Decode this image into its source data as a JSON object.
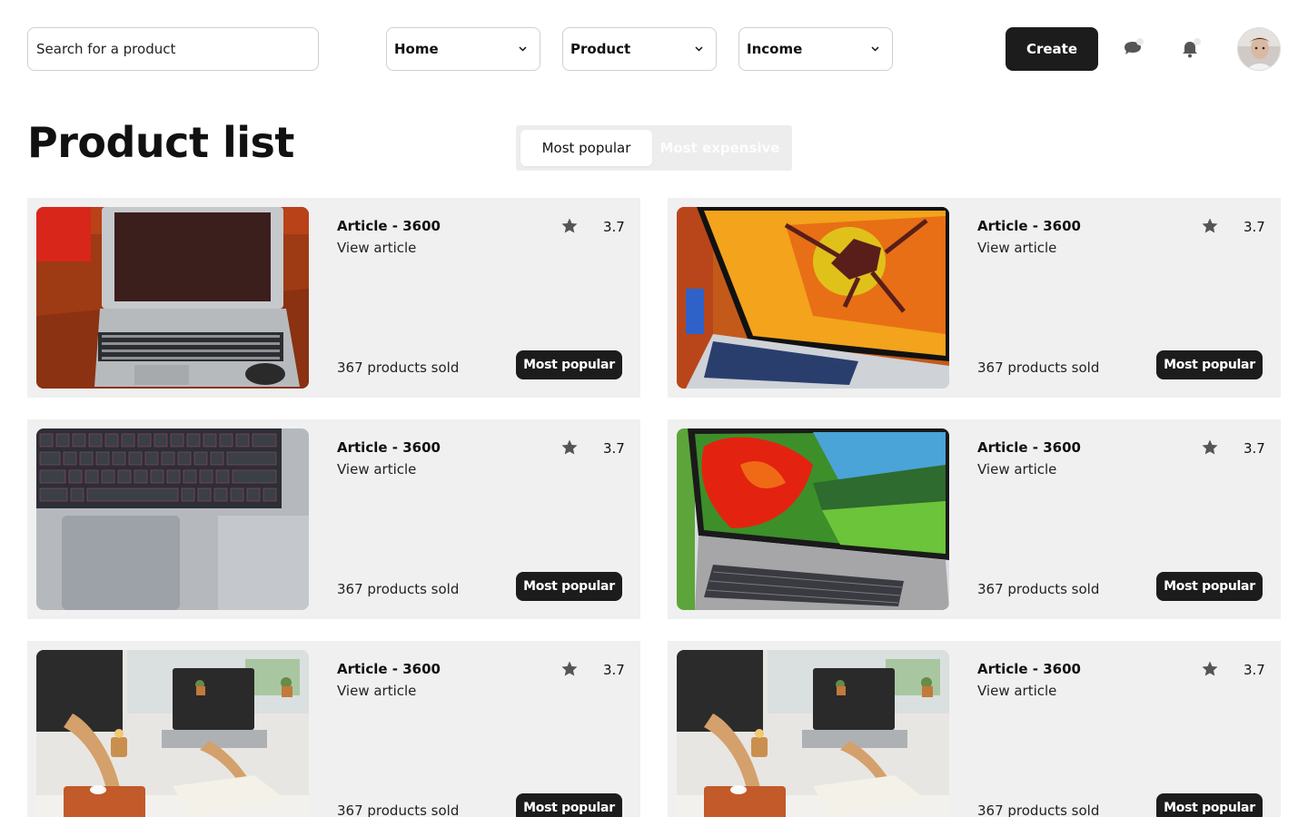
{
  "search": {
    "placeholder": "Search for a product",
    "value": ""
  },
  "nav": {
    "dropdowns": [
      {
        "label": "Home"
      },
      {
        "label": "Product"
      },
      {
        "label": "Income"
      }
    ],
    "create_label": "Create",
    "icons": [
      "chat-icon",
      "bell-icon",
      "avatar"
    ]
  },
  "page": {
    "title": "Product list",
    "tabs": [
      {
        "label": "Most popular",
        "active": true
      },
      {
        "label": "Most expensive",
        "active": false
      }
    ]
  },
  "colors": {
    "accent": "#1c1c1c",
    "card_bg": "#f0f0f0",
    "tab_bg": "#ededed",
    "star": "#555555"
  },
  "products": [
    {
      "title": "Article - 3600",
      "link": "View article",
      "rating": "3.7",
      "sold": "367 products sold",
      "badge": "Most popular",
      "image": "laptop-desk"
    },
    {
      "title": "Article - 3600",
      "link": "View article",
      "rating": "3.7",
      "sold": "367 products sold",
      "badge": "Most popular",
      "image": "laptop-orange-wallpaper"
    },
    {
      "title": "Article - 3600",
      "link": "View article",
      "rating": "3.7",
      "sold": "367 products sold",
      "badge": "Most popular",
      "image": "keyboard-closeup"
    },
    {
      "title": "Article - 3600",
      "link": "View article",
      "rating": "3.7",
      "sold": "367 products sold",
      "badge": "Most popular",
      "image": "laptop-flower-wallpaper"
    },
    {
      "title": "Article - 3600",
      "link": "View article",
      "rating": "3.7",
      "sold": "367 products sold",
      "badge": "Most popular",
      "image": "workspace-desk"
    },
    {
      "title": "Article - 3600",
      "link": "View article",
      "rating": "3.7",
      "sold": "367 products sold",
      "badge": "Most popular",
      "image": "workspace-desk"
    }
  ]
}
